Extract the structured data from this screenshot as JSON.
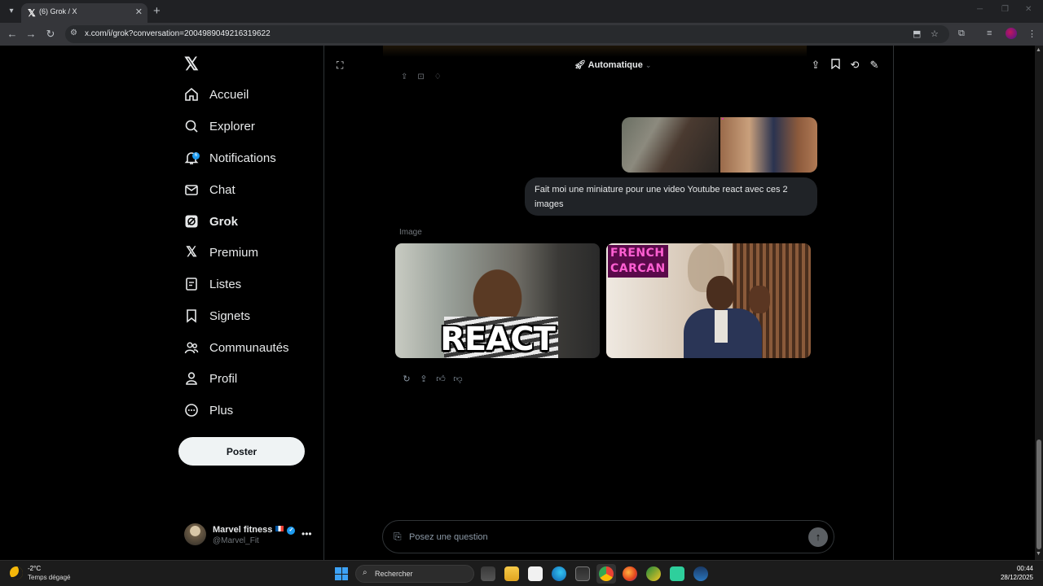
{
  "browser": {
    "tab_title": "(6) Grok / X",
    "url": "x.com/i/grok?conversation=2004989049216319622"
  },
  "sidebar": {
    "items": [
      {
        "label": "Accueil",
        "icon": "home-icon"
      },
      {
        "label": "Explorer",
        "icon": "search-icon"
      },
      {
        "label": "Notifications",
        "icon": "bell-icon",
        "badge": "6"
      },
      {
        "label": "Chat",
        "icon": "mail-icon"
      },
      {
        "label": "Grok",
        "icon": "grok-icon",
        "active": true
      },
      {
        "label": "Premium",
        "icon": "x-logo-icon"
      },
      {
        "label": "Listes",
        "icon": "list-icon"
      },
      {
        "label": "Signets",
        "icon": "bookmark-icon"
      },
      {
        "label": "Communautés",
        "icon": "communities-icon"
      },
      {
        "label": "Profil",
        "icon": "profile-icon"
      },
      {
        "label": "Plus",
        "icon": "more-circle-icon"
      }
    ],
    "post_button": "Poster",
    "account": {
      "name": "Marvel fitness",
      "handle": "@Marvel_Fit"
    }
  },
  "grok": {
    "mode": "Automatique",
    "user_message": "Fait moi une miniature pour une video Youtube react avec ces 2 images",
    "image_label": "Image",
    "generated_images": [
      {
        "overlay_text": "REACT"
      },
      {
        "overlay_text_lines": [
          "FRENCH",
          "CARCAN"
        ]
      }
    ],
    "input_placeholder": "Posez une question"
  },
  "taskbar": {
    "weather_temp": "-2°C",
    "weather_desc": "Temps dégagé",
    "search_label": "Rechercher",
    "time": "00:44",
    "date": "28/12/2025"
  },
  "colors": {
    "accent": "#1d9bf0",
    "background": "#000000",
    "post_button": "#eff3f4"
  }
}
